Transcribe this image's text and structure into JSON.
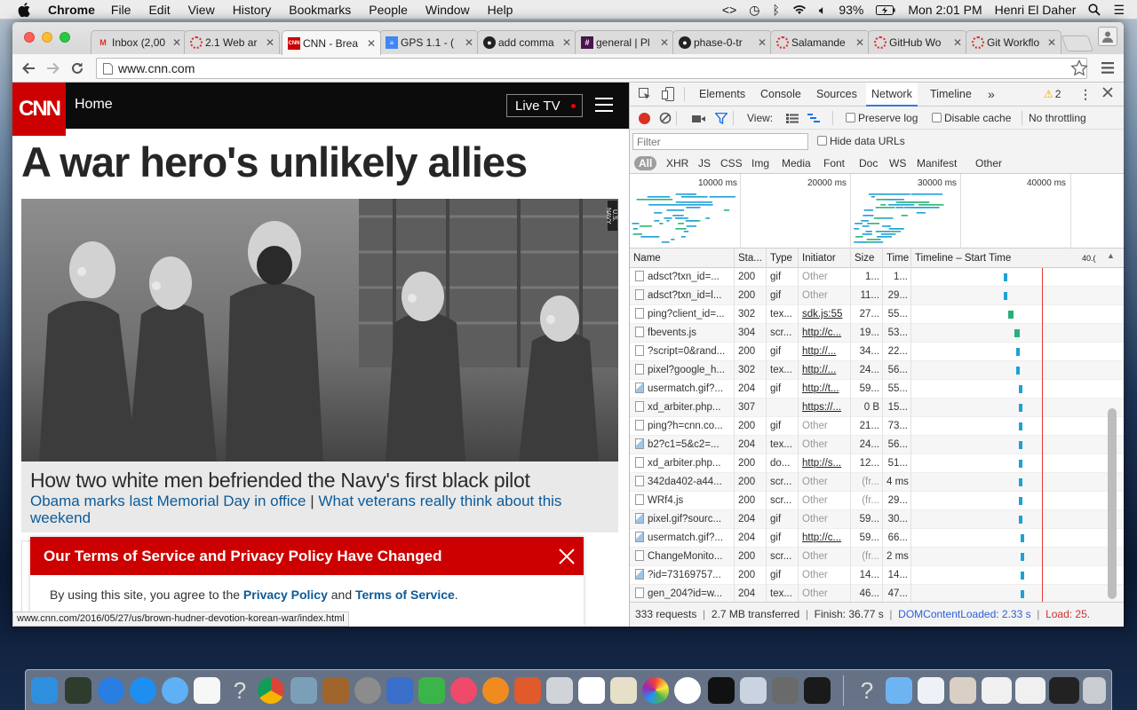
{
  "menubar": {
    "app": "Chrome",
    "menus": [
      "File",
      "Edit",
      "View",
      "History",
      "Bookmarks",
      "People",
      "Window",
      "Help"
    ],
    "battery": "93%",
    "clock": "Mon 2:01 PM",
    "user": "Henri El Daher"
  },
  "tabs": [
    {
      "icon": "gmail-icon",
      "title": "Inbox (2,00",
      "color": "#d93025"
    },
    {
      "icon": "loading-icon",
      "title": "2.1 Web ar",
      "color": "#d93025"
    },
    {
      "icon": "cnn-icon",
      "title": "CNN - Brea",
      "color": "#cc0000",
      "active": true
    },
    {
      "icon": "docs-icon",
      "title": "GPS 1.1 - (",
      "color": "#4285f4"
    },
    {
      "icon": "github-icon",
      "title": "add comma",
      "color": "#222222"
    },
    {
      "icon": "slack-icon",
      "title": "general | Pl",
      "color": "#4a154b"
    },
    {
      "icon": "github-icon",
      "title": "phase-0-tr",
      "color": "#222222"
    },
    {
      "icon": "loading-icon",
      "title": "Salamande",
      "color": "#d93025"
    },
    {
      "icon": "loading-icon",
      "title": "GitHub Wo",
      "color": "#d93025"
    },
    {
      "icon": "loading-icon",
      "title": "Git Workflo",
      "color": "#d93025"
    }
  ],
  "omnibox": {
    "url": "www.cnn.com"
  },
  "cnn": {
    "logo": "CNN",
    "section": "Home",
    "live_tv": "Live TV",
    "headline": "A war hero's unlikely allies",
    "image_credit": "U.S. NAVY",
    "caption_title": "How two white men befriended the Navy's first black pilot",
    "related_1": "Obama marks last Memorial Day in office",
    "separator": "|",
    "related_2": "What veterans really think about this weekend",
    "tos_title": "Our Terms of Service and Privacy Policy Have Changed",
    "tos_text_1": "By using this site, you agree to the ",
    "tos_link_1": "Privacy Policy",
    "tos_text_2": " and ",
    "tos_link_2": "Terms of Service",
    "tos_text_3": ".",
    "status_url": "www.cnn.com/2016/05/27/us/brown-hudner-devotion-korean-war/index.html"
  },
  "devtools": {
    "tabs": [
      "Elements",
      "Console",
      "Sources",
      "Network",
      "Timeline"
    ],
    "active_tab": "Network",
    "more": "»",
    "warnings": "2",
    "view_label": "View:",
    "preserve_log": "Preserve log",
    "disable_cache": "Disable cache",
    "throttling": "No throttling",
    "filter_placeholder": "Filter",
    "hide_data_urls": "Hide data URLs",
    "types": [
      "All",
      "XHR",
      "JS",
      "CSS",
      "Img",
      "Media",
      "Font",
      "Doc",
      "WS",
      "Manifest",
      "Other"
    ],
    "overview_ticks": [
      "10000 ms",
      "20000 ms",
      "30000 ms",
      "40000 ms"
    ],
    "columns": [
      "Name",
      "Sta...",
      "Type",
      "Initiator",
      "Size",
      "Time",
      "Timeline – Start Time",
      "40.("
    ],
    "rows": [
      {
        "name": "adsct?txn_id=...",
        "status": "200",
        "type": "gif",
        "initiator": "Other",
        "size": "1...",
        "time": "1...",
        "bar": 0.22,
        "img": false
      },
      {
        "name": "adsct?txn_id=l...",
        "status": "200",
        "type": "gif",
        "initiator": "Other",
        "size": "11...",
        "time": "29...",
        "bar": 0.22,
        "img": false
      },
      {
        "name": "ping?client_id=...",
        "status": "302",
        "type": "tex...",
        "initiator": "sdk.js:55",
        "size": "27...",
        "time": "55...",
        "bar": 0.23,
        "img": false
      },
      {
        "name": "fbevents.js",
        "status": "304",
        "type": "scr...",
        "initiator": "http://c...",
        "size": "19...",
        "time": "53...",
        "bar": 0.245,
        "img": false
      },
      {
        "name": "?script=0&rand...",
        "status": "200",
        "type": "gif",
        "initiator": "http://...",
        "size": "34...",
        "time": "22...",
        "bar": 0.25,
        "img": false
      },
      {
        "name": "pixel?google_h...",
        "status": "302",
        "type": "tex...",
        "initiator": "http://...",
        "size": "24...",
        "time": "56...",
        "bar": 0.25,
        "img": false
      },
      {
        "name": "usermatch.gif?...",
        "status": "204",
        "type": "gif",
        "initiator": "http://t...",
        "size": "59...",
        "time": "55...",
        "bar": 0.255,
        "img": true
      },
      {
        "name": "xd_arbiter.php...",
        "status": "307",
        "type": "",
        "initiator": "https://...",
        "size": "0 B",
        "time": "15...",
        "bar": 0.255,
        "img": false
      },
      {
        "name": "ping?h=cnn.co...",
        "status": "200",
        "type": "gif",
        "initiator": "Other",
        "size": "21...",
        "time": "73...",
        "bar": 0.255,
        "img": false
      },
      {
        "name": "b2?c1=5&c2=...",
        "status": "204",
        "type": "tex...",
        "initiator": "Other",
        "size": "24...",
        "time": "56...",
        "bar": 0.255,
        "img": true
      },
      {
        "name": "xd_arbiter.php...",
        "status": "200",
        "type": "do...",
        "initiator": "http://s...",
        "size": "12...",
        "time": "51...",
        "bar": 0.255,
        "img": false
      },
      {
        "name": "342da402-a44...",
        "status": "200",
        "type": "scr...",
        "initiator": "Other",
        "size": "(fr...",
        "time": "4 ms",
        "bar": 0.255,
        "img": false
      },
      {
        "name": "WRf4.js",
        "status": "200",
        "type": "scr...",
        "initiator": "Other",
        "size": "(fr...",
        "time": "29...",
        "bar": 0.255,
        "img": false
      },
      {
        "name": "pixel.gif?sourc...",
        "status": "204",
        "type": "gif",
        "initiator": "Other",
        "size": "59...",
        "time": "30...",
        "bar": 0.255,
        "img": true
      },
      {
        "name": "usermatch.gif?...",
        "status": "204",
        "type": "gif",
        "initiator": "http://c...",
        "size": "59...",
        "time": "66...",
        "bar": 0.26,
        "img": true
      },
      {
        "name": "ChangeMonito...",
        "status": "200",
        "type": "scr...",
        "initiator": "Other",
        "size": "(fr...",
        "time": "2 ms",
        "bar": 0.26,
        "img": false
      },
      {
        "name": "?id=73169757...",
        "status": "200",
        "type": "gif",
        "initiator": "Other",
        "size": "14...",
        "time": "14...",
        "bar": 0.26,
        "img": true
      },
      {
        "name": "gen_204?id=w...",
        "status": "204",
        "type": "tex...",
        "initiator": "Other",
        "size": "46...",
        "time": "47...",
        "bar": 0.26,
        "img": false
      }
    ],
    "summary": {
      "requests": "333 requests",
      "sep1": "  |  ",
      "transferred": "2.7 MB transferred",
      "sep2": "  |  ",
      "finish": "Finish: 36.77 s",
      "sep3": "  |  ",
      "dcl": "DOMContentLoaded: 2.33 s",
      "sep4": "  |  ",
      "load": "Load: 25.",
      "dcl_color": "#2b5fd9",
      "load_color": "#d32f2f"
    }
  }
}
